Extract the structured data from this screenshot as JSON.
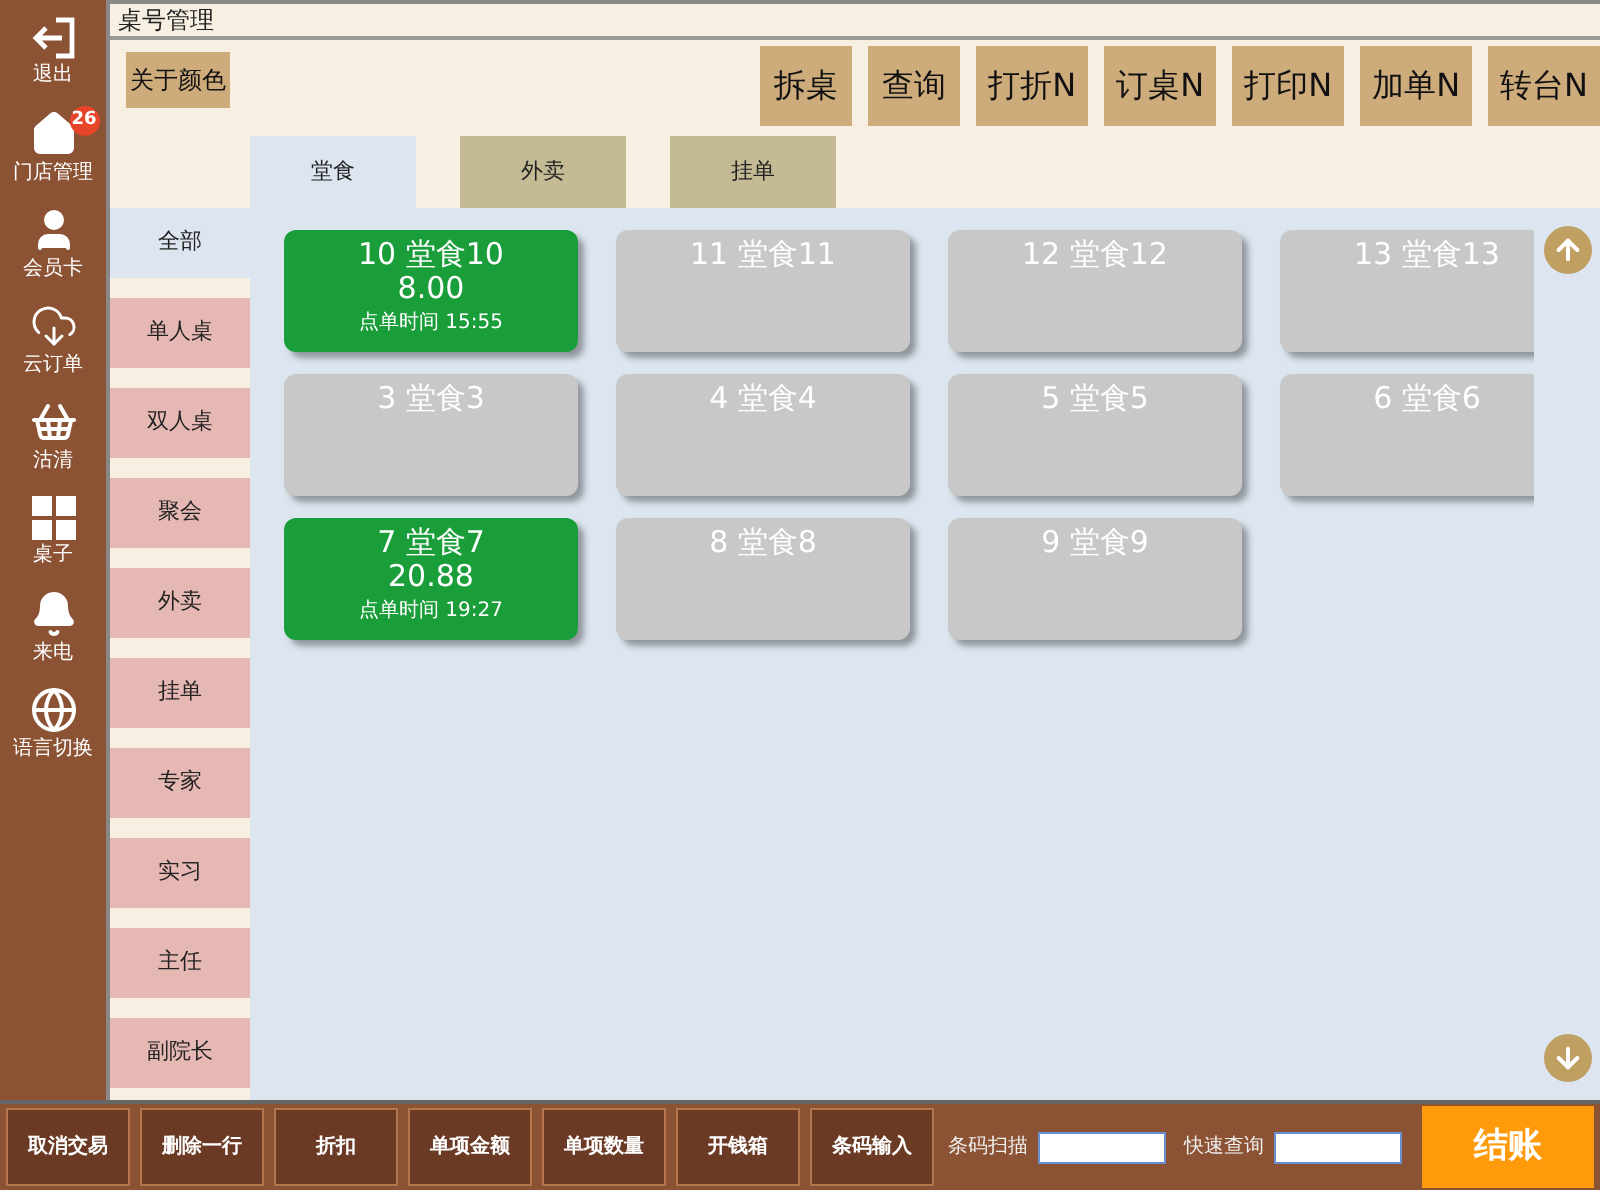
{
  "window": {
    "title": "桌号管理"
  },
  "sidebar": {
    "items": [
      {
        "kind": "logout",
        "label": "退出"
      },
      {
        "kind": "home",
        "label": "门店管理",
        "badge": "26"
      },
      {
        "kind": "user",
        "label": "会员卡"
      },
      {
        "kind": "cloud",
        "label": "云订单"
      },
      {
        "kind": "basket",
        "label": "沽清"
      },
      {
        "kind": "grid",
        "label": "桌子"
      },
      {
        "kind": "bell",
        "label": "来电"
      },
      {
        "kind": "globe",
        "label": "语言切换"
      }
    ]
  },
  "color_button": "关于颜色",
  "toolbar": [
    "拆桌",
    "查询",
    "打折N",
    "订桌N",
    "打印N",
    "加单N",
    "转台N"
  ],
  "tabs": [
    {
      "label": "堂食",
      "selected": true
    },
    {
      "label": "外卖",
      "selected": false
    },
    {
      "label": "挂单",
      "selected": false
    }
  ],
  "categories": [
    {
      "label": "全部",
      "selected": true
    },
    {
      "label": "单人桌",
      "selected": false
    },
    {
      "label": "双人桌",
      "selected": false
    },
    {
      "label": "聚会",
      "selected": false
    },
    {
      "label": "外卖",
      "selected": false
    },
    {
      "label": "挂单",
      "selected": false
    },
    {
      "label": "专家",
      "selected": false
    },
    {
      "label": "实习",
      "selected": false
    },
    {
      "label": "主任",
      "selected": false
    },
    {
      "label": "副院长",
      "selected": false
    }
  ],
  "tables": [
    {
      "name": "10 堂食10",
      "occupied": true,
      "amount": "8.00",
      "time": "点单时间 15:55"
    },
    {
      "name": "11 堂食11",
      "occupied": false
    },
    {
      "name": "12 堂食12",
      "occupied": false
    },
    {
      "name": "13 堂食13",
      "occupied": false
    },
    {
      "name": "3 堂食3",
      "occupied": false
    },
    {
      "name": "4 堂食4",
      "occupied": false
    },
    {
      "name": "5 堂食5",
      "occupied": false
    },
    {
      "name": "6 堂食6",
      "occupied": false
    },
    {
      "name": "7 堂食7",
      "occupied": true,
      "amount": "20.88",
      "time": "点单时间 19:27"
    },
    {
      "name": "8 堂食8",
      "occupied": false
    },
    {
      "name": "9 堂食9",
      "occupied": false
    }
  ],
  "bottom_buttons": [
    "取消交易",
    "删除一行",
    "折扣",
    "单项金额",
    "单项数量",
    "开钱箱",
    "条码输入"
  ],
  "barcode_field": {
    "label": "条码扫描"
  },
  "quick_search_field": {
    "label": "快速查询"
  },
  "checkout_button": "结账"
}
